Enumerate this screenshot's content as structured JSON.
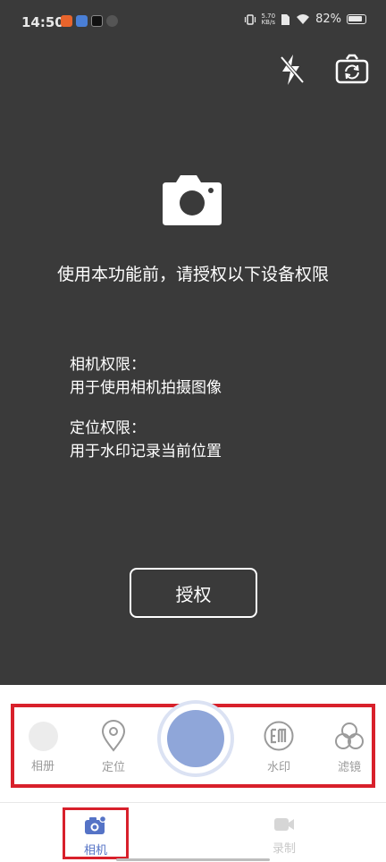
{
  "status_bar": {
    "time": "14:50",
    "net_speed_value": "5.70",
    "net_speed_unit": "KB/s",
    "battery": "82%"
  },
  "permission": {
    "title": "使用本功能前，请授权以下设备权限",
    "camera_heading": "相机权限：",
    "camera_desc": "用于使用相机拍摄图像",
    "location_heading": "定位权限：",
    "location_desc": "用于水印记录当前位置",
    "authorize_label": "授权"
  },
  "toolbar": {
    "album_label": "相册",
    "location_label": "定位",
    "watermark_label": "水印",
    "filter_label": "滤镜"
  },
  "tabs": {
    "camera_label": "相机",
    "record_label": "录制"
  },
  "colors": {
    "camera_bg": "#3a3a3a",
    "accent": "#5573c6",
    "shutter": "#8fa6d9",
    "highlight_border": "#d8202b"
  }
}
